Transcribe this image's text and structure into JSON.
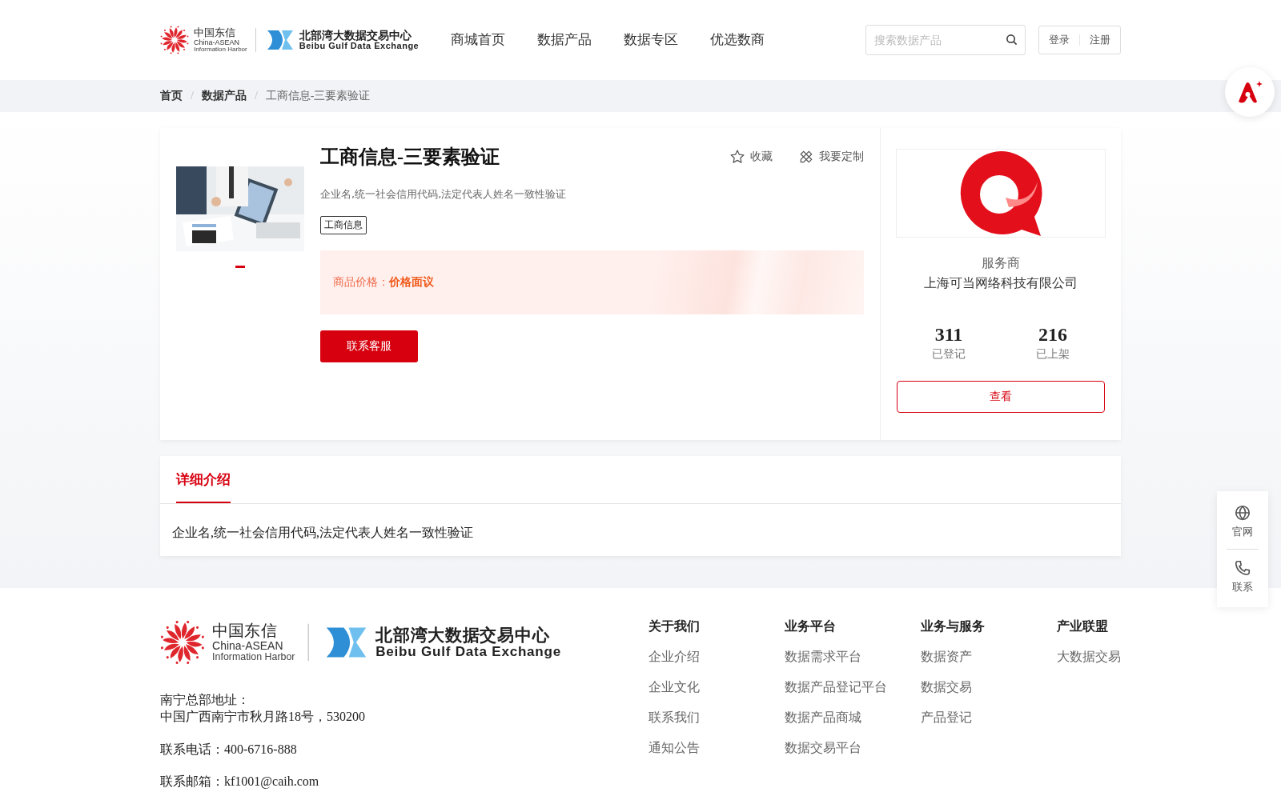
{
  "header": {
    "logo": {
      "cn": "中国东信",
      "en1": "China-ASEAN",
      "en2": "Information Harbor",
      "bx_cn": "北部湾大数据交易中心",
      "bx_en": "Beibu Gulf Data Exchange"
    },
    "nav": [
      {
        "label": "商城首页",
        "selected": false
      },
      {
        "label": "数据产品",
        "selected": false
      },
      {
        "label": "数据专区",
        "selected": false
      },
      {
        "label": "优选数商",
        "selected": false
      }
    ],
    "search": {
      "placeholder": "搜索数据产品"
    },
    "login": "登录",
    "register": "注册"
  },
  "breadcrumb": {
    "separator": "/",
    "items": [
      "首页",
      "数据产品",
      "工商信息-三要素验证"
    ]
  },
  "product": {
    "gallery": [
      {
        "kind": "picture",
        "selected": true
      }
    ],
    "title": "工商信息-三要素验证",
    "favorite": "收藏",
    "customize": "我要定制",
    "summary": "企业名,统一社会信用代码,法定代表人姓名一致性验证",
    "tags": [
      "工商信息"
    ],
    "price_label": "商品价格：",
    "price_value": "价格面议",
    "contact_button": "联系客服"
  },
  "provider": {
    "label": "服务商",
    "name": "上海可当网络科技有限公司",
    "stats": [
      {
        "value": "311",
        "label": "已登记"
      },
      {
        "value": "216",
        "label": "已上架"
      }
    ],
    "view_button": "查看"
  },
  "detail": {
    "tabs": [
      {
        "label": "详细介绍",
        "selected": true
      }
    ],
    "body": "企业名,统一社会信用代码,法定代表人姓名一致性验证"
  },
  "side_panel": [
    {
      "kind": "globe",
      "label": "官网"
    },
    {
      "kind": "phone",
      "label": "联系"
    }
  ],
  "footer": {
    "logo": {
      "cn": "中国东信",
      "en1": "China-ASEAN",
      "en2": "Information Harbor",
      "bx_cn": "北部湾大数据交易中心",
      "bx_en": "Beibu Gulf Data Exchange"
    },
    "address_label": "南宁总部地址：",
    "address": "中国广西南宁市秋月路18号，530200",
    "phone": "联系电话：400-6716-888",
    "email": "联系邮箱：kf1001@caih.com",
    "columns": [
      {
        "title": "关于我们",
        "links": [
          "企业介绍",
          "企业文化",
          "联系我们",
          "通知公告"
        ]
      },
      {
        "title": "业务平台",
        "links": [
          "数据需求平台",
          "数据产品登记平台",
          "数据产品商城",
          "数据交易平台"
        ]
      },
      {
        "title": "业务与服务",
        "links": [
          "数据资产",
          "数据交易",
          "产品登记"
        ]
      },
      {
        "title": "产业联盟",
        "links": [
          "大数据交易"
        ]
      }
    ]
  }
}
